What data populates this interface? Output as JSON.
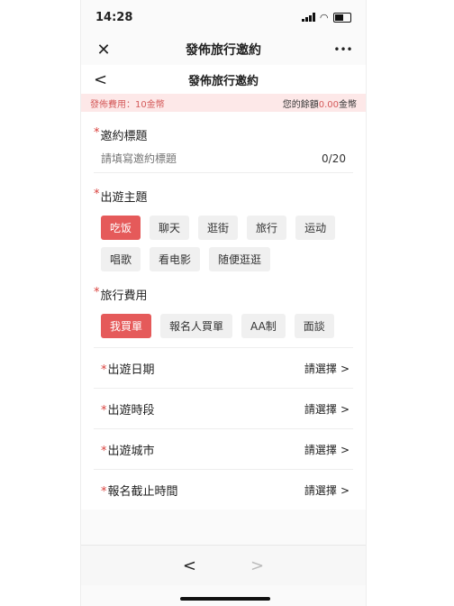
{
  "status": {
    "time": "14:28"
  },
  "webview": {
    "title": "發佈旅行邀約",
    "close_icon": "✕",
    "more_icon": "•••"
  },
  "page": {
    "title": "發佈旅行邀約",
    "back_icon": "<"
  },
  "fee_banner": {
    "left": "發佈費用：10金幣",
    "right_prefix": "您的餘額",
    "balance": "0.00",
    "unit": "金幣"
  },
  "form": {
    "invite_title": {
      "label": "邀約標題",
      "placeholder": "請填寫邀約標題",
      "counter": "0/20"
    },
    "theme": {
      "label": "出遊主題",
      "options": [
        "吃饭",
        "聊天",
        "逛街",
        "旅行",
        "运动",
        "唱歌",
        "看电影",
        "随便逛逛"
      ],
      "selected": "吃饭"
    },
    "cost": {
      "label": "旅行費用",
      "options": [
        "我買單",
        "報名人買單",
        "AA制",
        "面談"
      ],
      "selected": "我買單"
    },
    "rows": [
      {
        "label": "出遊日期",
        "value": "請選擇"
      },
      {
        "label": "出遊時段",
        "value": "請選擇"
      },
      {
        "label": "出遊城市",
        "value": "請選擇"
      },
      {
        "label": "報名截止時間",
        "value": "請選擇"
      }
    ],
    "required_mark": "*",
    "chevron": ">"
  },
  "nav": {
    "back": "<",
    "forward": ">"
  }
}
